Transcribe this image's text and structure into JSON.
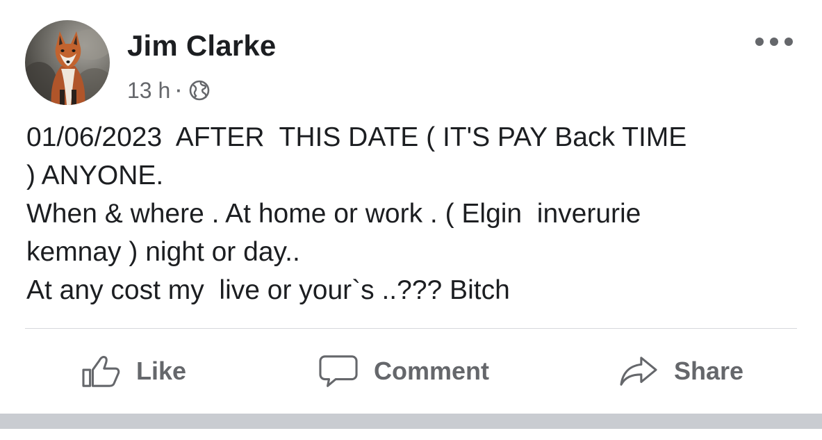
{
  "post": {
    "author_name": "Jim Clarke",
    "timestamp": "13 h",
    "separator": "·",
    "audience_icon": "globe-icon",
    "more_icon": "more-options-icon",
    "avatar_icon": "fox-profile-photo",
    "text_lines": [
      "01/06/2023  AFTER  THIS DATE ( IT'S PAY Back TIME",
      ") ANYONE.",
      "When & where . At home or work . ( Elgin  inverurie",
      "kemnay ) night or day..",
      "At any cost my  live or your`s ..??? Bitch"
    ]
  },
  "actions": {
    "like": {
      "label": "Like",
      "icon": "thumbs-up-icon"
    },
    "comment": {
      "label": "Comment",
      "icon": "speech-bubble-icon"
    },
    "share": {
      "label": "Share",
      "icon": "share-arrow-icon"
    }
  },
  "colors": {
    "text_primary": "#1c1e21",
    "text_secondary": "#65676b",
    "divider": "#d6d8dc",
    "footer_bar": "#c9ccd1"
  }
}
